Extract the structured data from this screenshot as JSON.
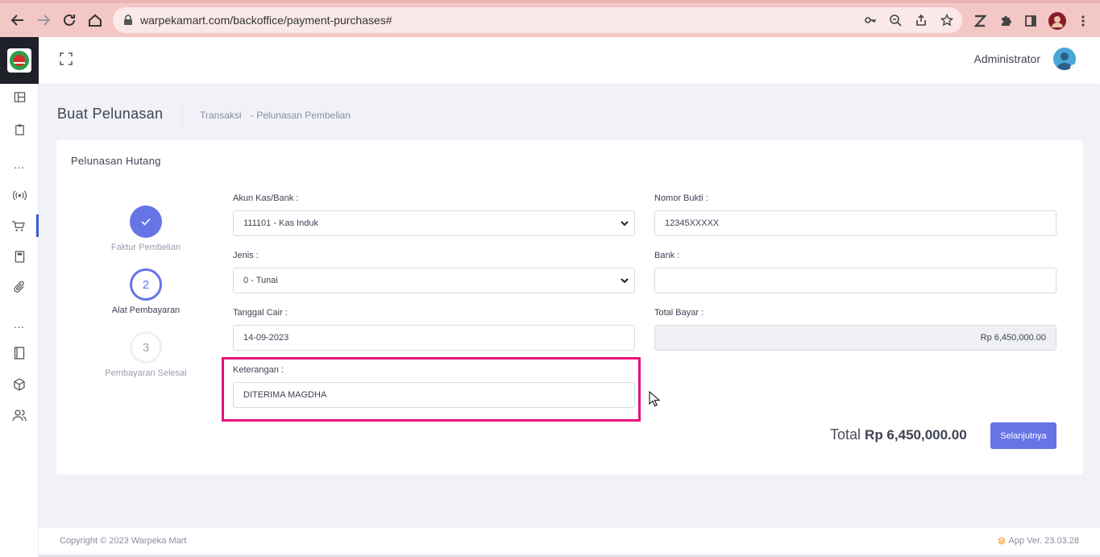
{
  "browser": {
    "url": "warpekamart.com/backoffice/payment-purchases#"
  },
  "header": {
    "user_name": "Administrator"
  },
  "page": {
    "title": "Buat Pelunasan",
    "breadcrumb": [
      "Transaksi",
      "- Pelunasan Pembelian"
    ]
  },
  "card": {
    "title": "Pelunasan Hutang",
    "steps": [
      {
        "number": "✓",
        "label": "Faktur Pembelian",
        "state": "done"
      },
      {
        "number": "2",
        "label": "Alat Pembayaran",
        "state": "current"
      },
      {
        "number": "3",
        "label": "Pembayaran Selesai",
        "state": "todo"
      }
    ],
    "fields": {
      "akun_label": "Akun Kas/Bank :",
      "akun_value": "111101 - Kas Induk",
      "jenis_label": "Jenis :",
      "jenis_value": "0 - Tunai",
      "tanggal_label": "Tanggal Cair :",
      "tanggal_value": "14-09-2023",
      "keterangan_label": "Keterangan :",
      "keterangan_value": "DITERIMA MAGDHA",
      "nomor_label": "Nomor Bukti :",
      "nomor_value": "12345XXXXX",
      "bank_label": "Bank :",
      "bank_value": "",
      "total_bayar_label": "Total Bayar :",
      "total_bayar_value": "Rp 6,450,000.00"
    },
    "total_label": "Total",
    "total_value": "Rp 6,450,000.00",
    "next_label": "Selanjutnya"
  },
  "footer": {
    "copyright": "Copyright © 2023 Warpeka Mart",
    "version": "App Ver. 23.03.28"
  },
  "colors": {
    "accent": "#6674e6",
    "highlight": "#e5127d",
    "chrome": "#f4c7c7"
  }
}
